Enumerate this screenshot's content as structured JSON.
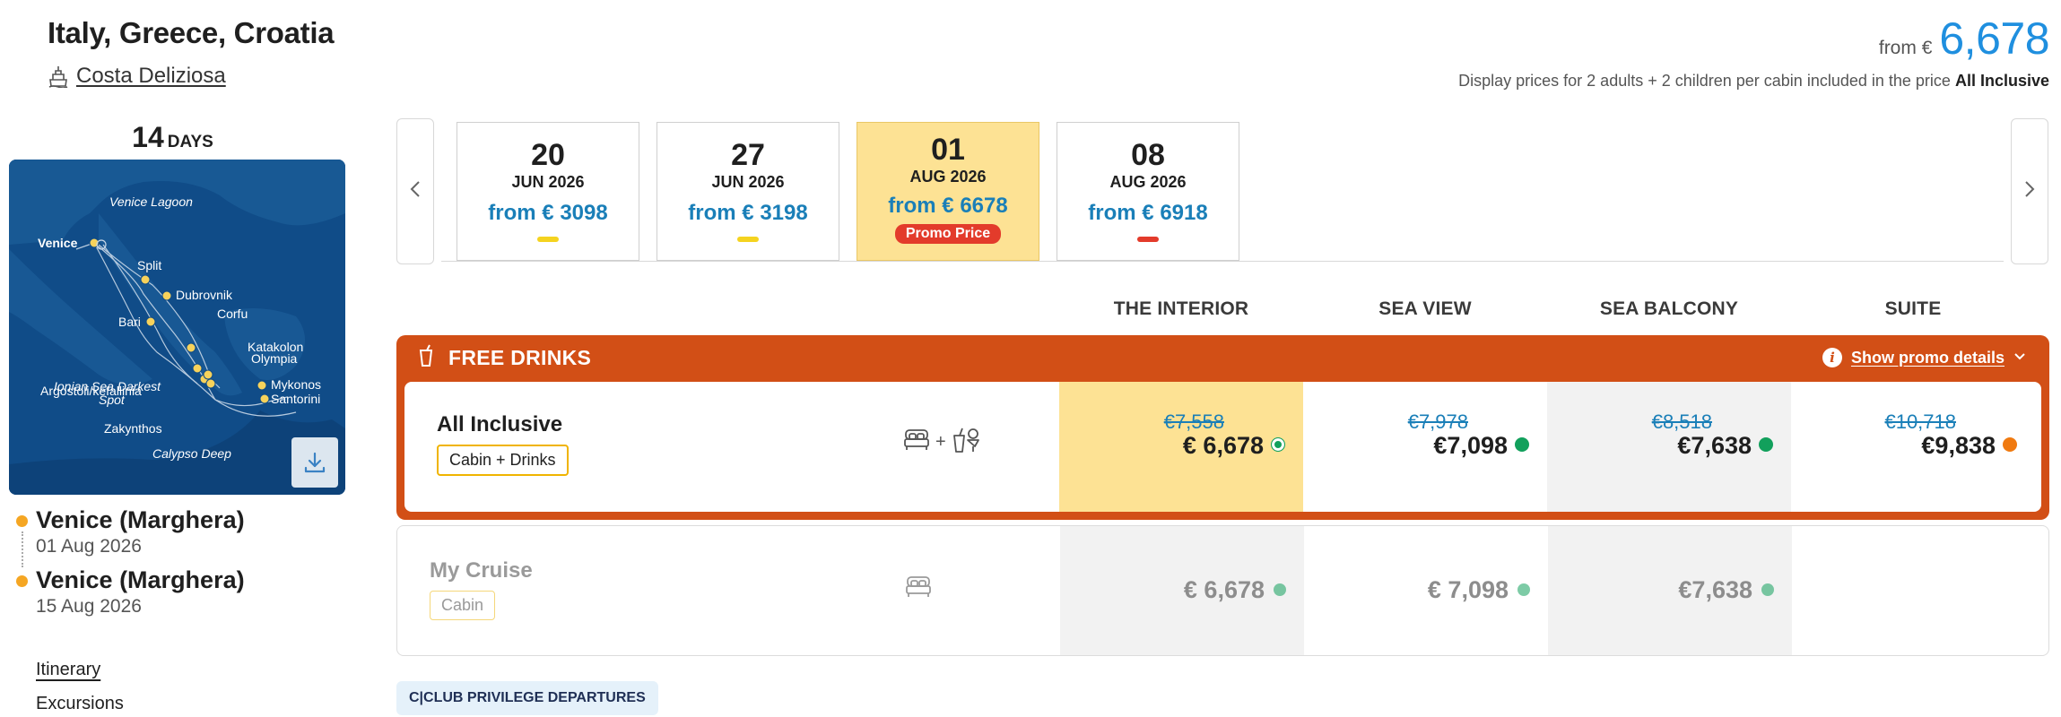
{
  "header": {
    "title": "Italy, Greece, Croatia",
    "ship_name": "Costa Deliziosa",
    "price_from_label": "from €",
    "price_from_value": "6,678",
    "disclaimer_text": "Display prices for 2 adults + 2 children per cabin included in the price",
    "disclaimer_bold": "All Inclusive"
  },
  "itinerary": {
    "days_number": "14",
    "days_unit": "DAYS",
    "map_labels": {
      "venice_lagoon": "Venice Lagoon",
      "venice": "Venice",
      "split": "Split",
      "dubrovnik": "Dubrovnik",
      "bari": "Bari",
      "corfu": "Corfu",
      "ionian_1": "Ionian Sea Darkest",
      "ionian_2": "Spot",
      "katakolon_1": "Katakolon",
      "katakolon_2": "Olympia",
      "argostoli": "Argostoli/kefallinia",
      "mykonos": "Mykonos",
      "santorini": "Santorini",
      "zakynthos": "Zakynthos",
      "calypso": "Calypso Deep"
    },
    "embark": {
      "port": "Venice (Marghera)",
      "date": "01 Aug 2026"
    },
    "disembark": {
      "port": "Venice (Marghera)",
      "date": "15 Aug 2026"
    },
    "links": {
      "itinerary": "Itinerary",
      "excursions": "Excursions"
    }
  },
  "dates": [
    {
      "day": "20",
      "month": "JUN 2026",
      "price": "from € 3098",
      "indicator_color": "#f5d31f",
      "selected": false
    },
    {
      "day": "27",
      "month": "JUN 2026",
      "price": "from € 3198",
      "indicator_color": "#f5d31f",
      "selected": false
    },
    {
      "day": "01",
      "month": "AUG 2026",
      "price": "from € 6678",
      "badge": "Promo Price",
      "selected": true
    },
    {
      "day": "08",
      "month": "AUG 2026",
      "price": "from € 6918",
      "indicator_color": "#e33b2b",
      "selected": false
    }
  ],
  "nav": {
    "prev_icon": "chevron-left-icon",
    "next_icon": "chevron-right-icon"
  },
  "cabin_types": [
    "THE INTERIOR",
    "SEA VIEW",
    "SEA BALCONY",
    "SUITE"
  ],
  "promo": {
    "title": "FREE DRINKS",
    "details_link": "Show promo details",
    "packages": [
      {
        "name": "All Inclusive",
        "tag": "Cabin + Drinks",
        "icons": [
          "bed-icon",
          "drinks-icon"
        ],
        "plus": "+",
        "prices": [
          {
            "old": "€7,558",
            "now": "€ 6,678",
            "status_color": "#12a05c"
          },
          {
            "old": "€7,978",
            "now": "€7,098",
            "status_color": "#12a05c"
          },
          {
            "old": "€8,518",
            "now": "€7,638",
            "status_color": "#12a05c"
          },
          {
            "old": "€10,718",
            "now": "€9,838",
            "status_color": "#f07a10"
          }
        ]
      }
    ]
  },
  "standard": {
    "name": "My Cruise",
    "tag": "Cabin",
    "icons": [
      "bed-icon"
    ],
    "prices": [
      {
        "now": "€ 6,678",
        "status_color": "#12a05c"
      },
      {
        "now": "€ 7,098",
        "status_color": "#12a05c"
      },
      {
        "now": "€7,638",
        "status_color": "#12a05c"
      }
    ]
  },
  "club_badge": "C|CLUB PRIVILEGE DEPARTURES"
}
